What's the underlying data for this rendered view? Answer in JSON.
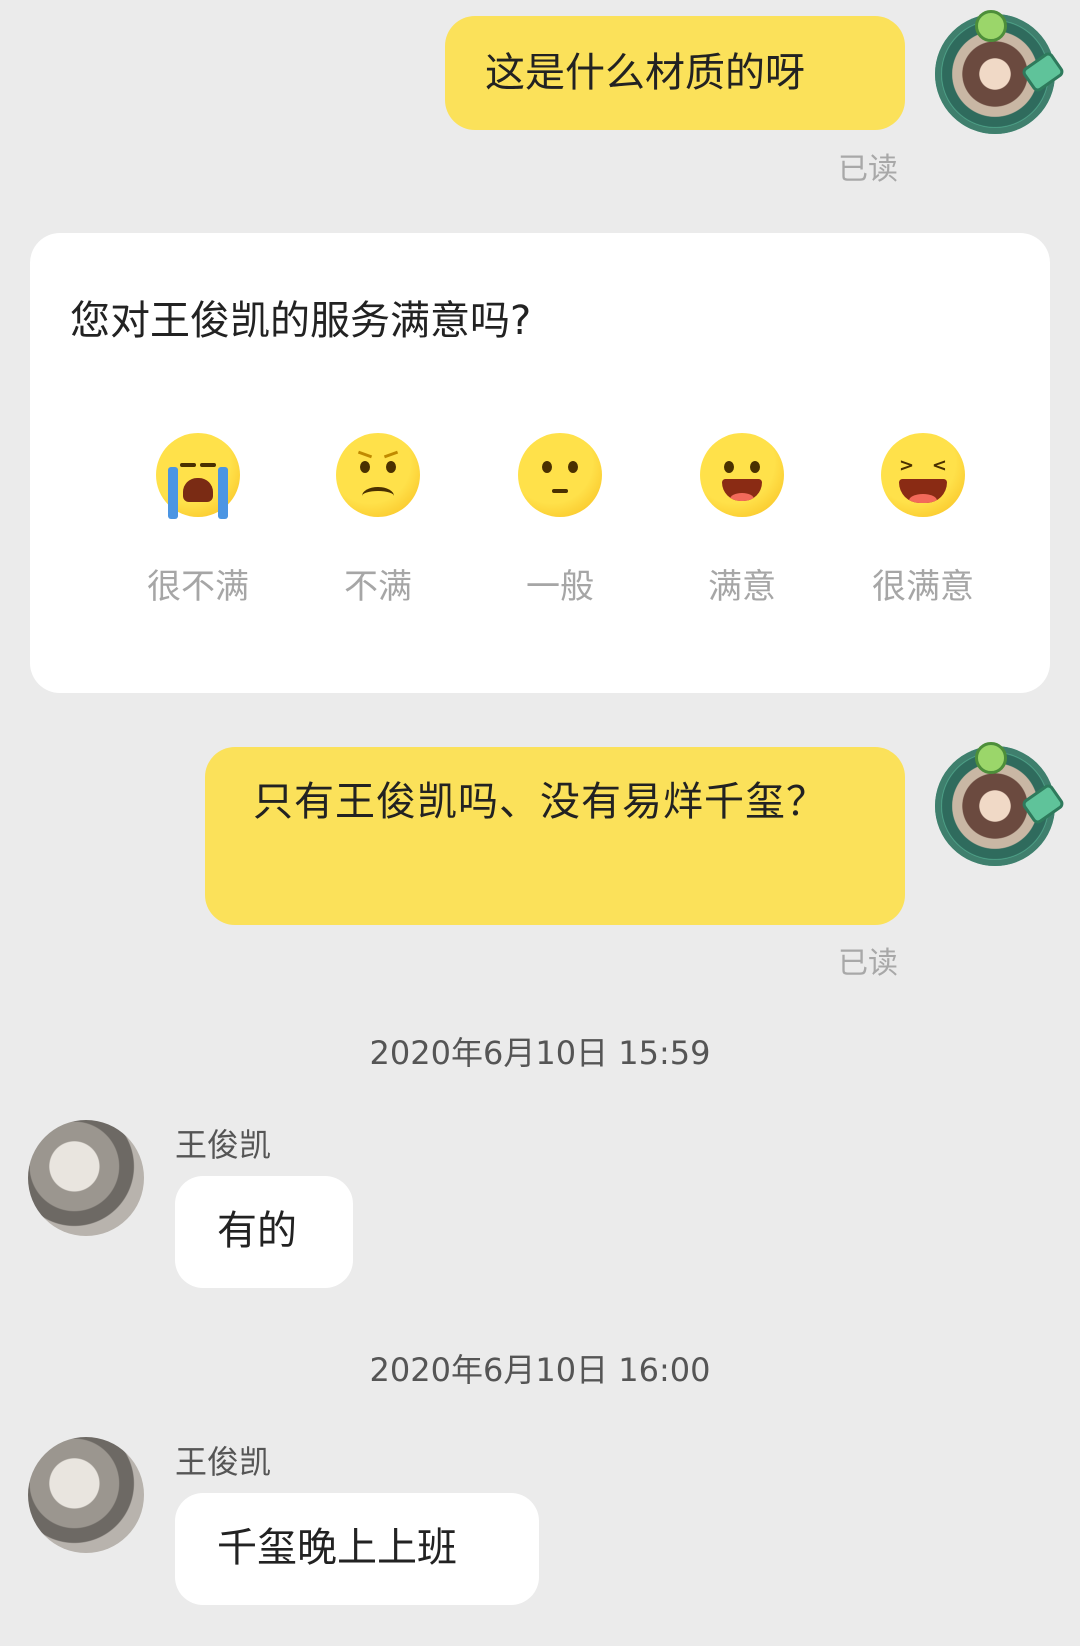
{
  "messages_out": [
    {
      "text": "这是什么材质的呀",
      "status": "已读"
    },
    {
      "text": "只有王俊凯吗、没有易烊千玺？",
      "status": "已读"
    }
  ],
  "rating_card": {
    "question": "您对王俊凯的服务满意吗?",
    "options": [
      {
        "label": "很不满",
        "icon": "crying-face-icon"
      },
      {
        "label": "不满",
        "icon": "frowning-face-icon"
      },
      {
        "label": "一般",
        "icon": "neutral-face-icon"
      },
      {
        "label": "满意",
        "icon": "smiling-face-icon"
      },
      {
        "label": "很满意",
        "icon": "laughing-face-icon"
      }
    ],
    "colors": {
      "face": "#ffd83a",
      "label": "#a6a6a6"
    }
  },
  "timestamps": [
    "2020年6月10日 15:59",
    "2020年6月10日 16:00"
  ],
  "messages_in": [
    {
      "sender": "王俊凯",
      "text": "有的"
    },
    {
      "sender": "王俊凯",
      "text": "千玺晚上上班"
    }
  ],
  "colors": {
    "background": "#ebebeb",
    "outgoing_bubble": "#fbe15a",
    "incoming_bubble": "#ffffff"
  }
}
